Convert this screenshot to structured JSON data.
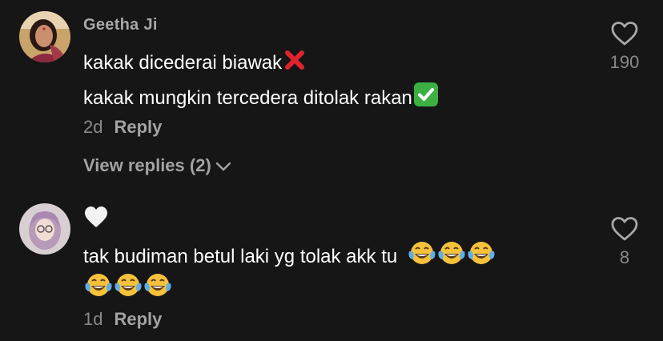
{
  "comments": [
    {
      "username": "Geetha Ji",
      "lines": [
        "kakak dicederai biawak",
        "kakak mungkin tercedera ditolak rakan"
      ],
      "line_emojis": [
        "cross-mark-emoji",
        "check-mark-emoji"
      ],
      "age": "2d",
      "reply_label": "Reply",
      "view_replies_label": "View replies (2)",
      "likes": "190"
    },
    {
      "username": "",
      "creator_heart": "white-heart-icon",
      "lines": [
        "tak budiman betul laki yg tolak akk tu",
        ""
      ],
      "line_emojis": [
        "laughing-tears-emoji x3",
        "laughing-tears-emoji x3"
      ],
      "age": "1d",
      "reply_label": "Reply",
      "likes": "8"
    }
  ],
  "colors": {
    "background": "#161616",
    "text_primary": "#ffffff",
    "text_secondary": "#a8a8a8",
    "cross_red": "#e0242b",
    "check_green": "#3cb043"
  }
}
